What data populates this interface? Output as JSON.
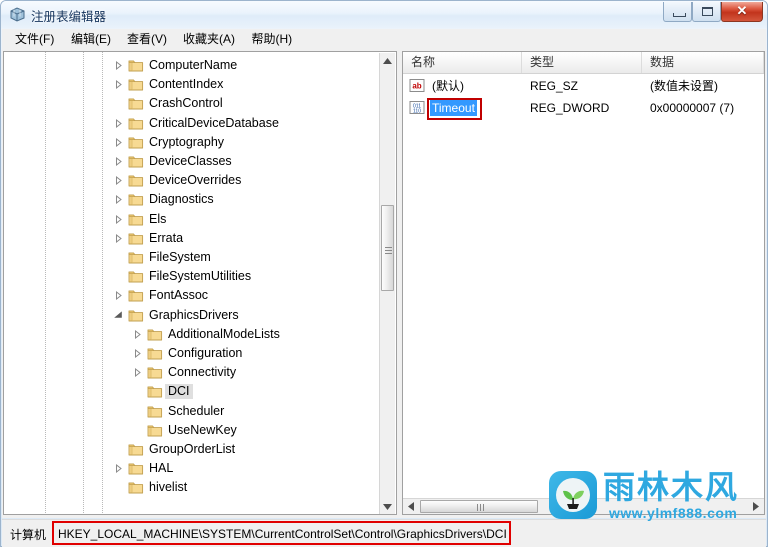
{
  "window": {
    "title": "注册表编辑器",
    "icon": "regedit-icon",
    "controls": {
      "minimize_label": "",
      "maximize_label": "",
      "close_label": "✕"
    }
  },
  "menubar": {
    "items": [
      {
        "label": "文件(F)",
        "name": "menu-file"
      },
      {
        "label": "编辑(E)",
        "name": "menu-edit"
      },
      {
        "label": "查看(V)",
        "name": "menu-view"
      },
      {
        "label": "收藏夹(A)",
        "name": "menu-favorites"
      },
      {
        "label": "帮助(H)",
        "name": "menu-help"
      }
    ]
  },
  "tree": {
    "items": [
      {
        "label": "ComputerName",
        "depth": 0,
        "state": "collapsed",
        "selected": false
      },
      {
        "label": "ContentIndex",
        "depth": 0,
        "state": "collapsed",
        "selected": false
      },
      {
        "label": "CrashControl",
        "depth": 0,
        "state": "leaf",
        "selected": false
      },
      {
        "label": "CriticalDeviceDatabase",
        "depth": 0,
        "state": "collapsed",
        "selected": false
      },
      {
        "label": "Cryptography",
        "depth": 0,
        "state": "collapsed",
        "selected": false
      },
      {
        "label": "DeviceClasses",
        "depth": 0,
        "state": "collapsed",
        "selected": false
      },
      {
        "label": "DeviceOverrides",
        "depth": 0,
        "state": "collapsed",
        "selected": false
      },
      {
        "label": "Diagnostics",
        "depth": 0,
        "state": "collapsed",
        "selected": false
      },
      {
        "label": "Els",
        "depth": 0,
        "state": "collapsed",
        "selected": false
      },
      {
        "label": "Errata",
        "depth": 0,
        "state": "collapsed",
        "selected": false
      },
      {
        "label": "FileSystem",
        "depth": 0,
        "state": "leaf",
        "selected": false
      },
      {
        "label": "FileSystemUtilities",
        "depth": 0,
        "state": "leaf",
        "selected": false
      },
      {
        "label": "FontAssoc",
        "depth": 0,
        "state": "collapsed",
        "selected": false
      },
      {
        "label": "GraphicsDrivers",
        "depth": 0,
        "state": "expanded",
        "selected": false
      },
      {
        "label": "AdditionalModeLists",
        "depth": 1,
        "state": "collapsed",
        "selected": false
      },
      {
        "label": "Configuration",
        "depth": 1,
        "state": "collapsed",
        "selected": false
      },
      {
        "label": "Connectivity",
        "depth": 1,
        "state": "collapsed",
        "selected": false
      },
      {
        "label": "DCI",
        "depth": 1,
        "state": "leaf",
        "selected": true
      },
      {
        "label": "Scheduler",
        "depth": 1,
        "state": "leaf",
        "selected": false
      },
      {
        "label": "UseNewKey",
        "depth": 1,
        "state": "leaf",
        "selected": false
      },
      {
        "label": "GroupOrderList",
        "depth": 0,
        "state": "leaf",
        "selected": false
      },
      {
        "label": "HAL",
        "depth": 0,
        "state": "collapsed",
        "selected": false
      },
      {
        "label": "hivelist",
        "depth": 0,
        "state": "leaf",
        "selected": false
      }
    ]
  },
  "list": {
    "columns": [
      {
        "label": "名称",
        "name": "column-name"
      },
      {
        "label": "类型",
        "name": "column-type"
      },
      {
        "label": "数据",
        "name": "column-data"
      }
    ],
    "rows": [
      {
        "name": "(默认)",
        "type": "REG_SZ",
        "data": "(数值未设置)",
        "icon": "string-value-icon",
        "selected": false,
        "annotated": false
      },
      {
        "name": "Timeout",
        "type": "REG_DWORD",
        "data": "0x00000007 (7)",
        "icon": "binary-value-icon",
        "selected": true,
        "annotated": true
      }
    ]
  },
  "statusbar": {
    "computer_label": "计算机",
    "path": "HKEY_LOCAL_MACHINE\\SYSTEM\\CurrentControlSet\\Control\\GraphicsDrivers\\DCI"
  },
  "watermark": {
    "brand": "雨林木风",
    "url": "www.ylmf888.com"
  },
  "colors": {
    "selection_blue": "#3399ff",
    "annotation_red": "#c00000",
    "close_button_red": "#c2341c",
    "watermark_blue": "#2fa8e0",
    "tree_selection_gray": "#dfdfdf"
  }
}
